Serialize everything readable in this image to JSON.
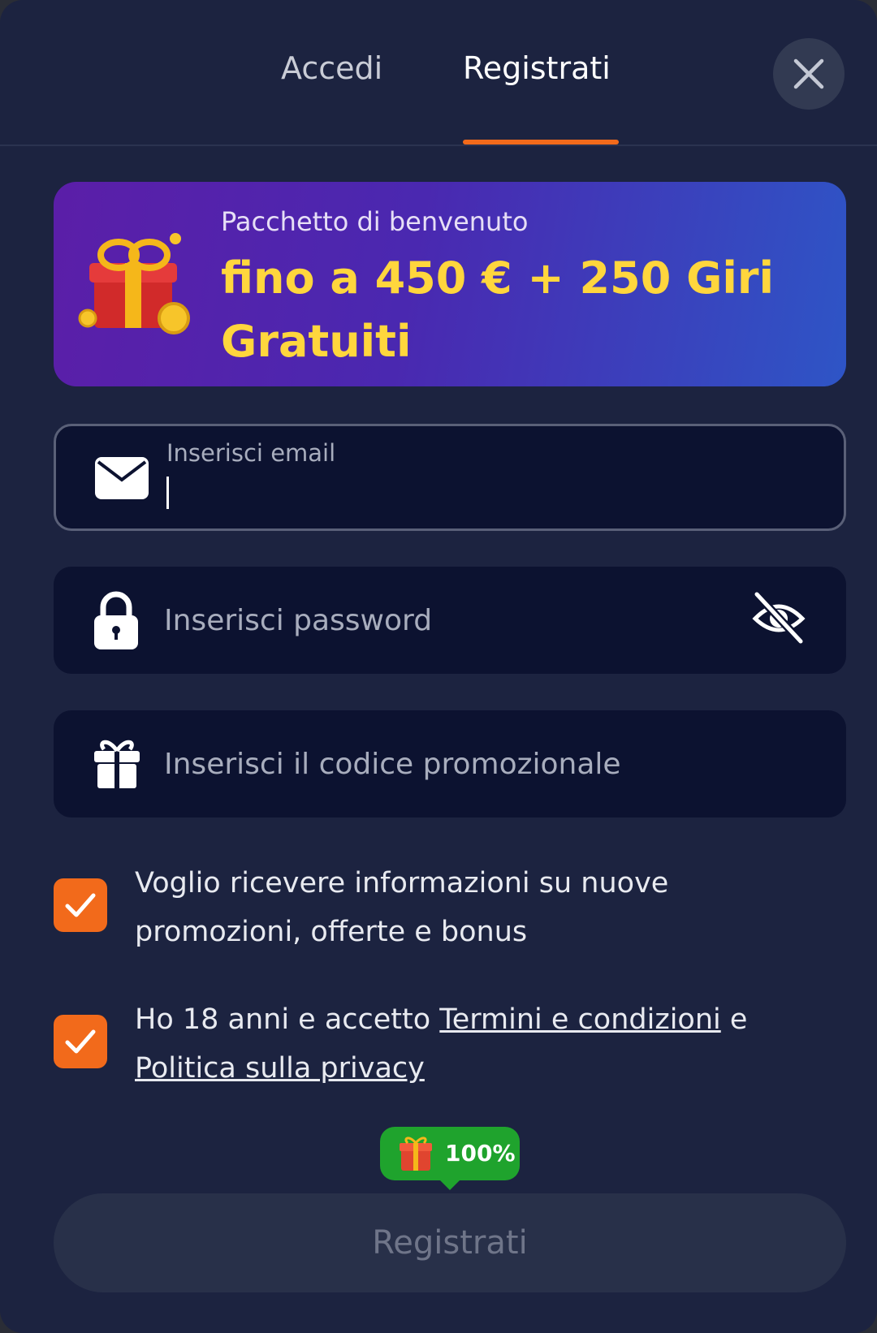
{
  "tabs": [
    {
      "label": "Accedi",
      "active": false
    },
    {
      "label": "Registrati",
      "active": true
    }
  ],
  "accent_color": "#f26a1b",
  "banner": {
    "subtitle": "Pacchetto di benvenuto",
    "title": "fino a 450 € + 250 Giri Gratuiti"
  },
  "form": {
    "email": {
      "label": "Inserisci email",
      "value": ""
    },
    "password": {
      "placeholder": "Inserisci password",
      "value": ""
    },
    "promo": {
      "placeholder": "Inserisci il codice promozionale",
      "value": ""
    }
  },
  "checkboxes": {
    "news": {
      "checked": true,
      "text": "Voglio ricevere informazioni su nuove promozioni, offerte e bonus"
    },
    "age": {
      "checked": true,
      "text_before": "Ho 18 anni e accetto ",
      "terms_link": "Termini e condizioni",
      "text_middle": " e ",
      "privacy_link": "Politica sulla privacy"
    }
  },
  "bonus_badge": {
    "value": "100%"
  },
  "submit": {
    "label": "Registrati"
  },
  "icons": [
    "close-icon",
    "gift-box-icon",
    "envelope-icon",
    "lock-icon",
    "eye-off-icon",
    "gift-icon",
    "checkmark-icon"
  ]
}
